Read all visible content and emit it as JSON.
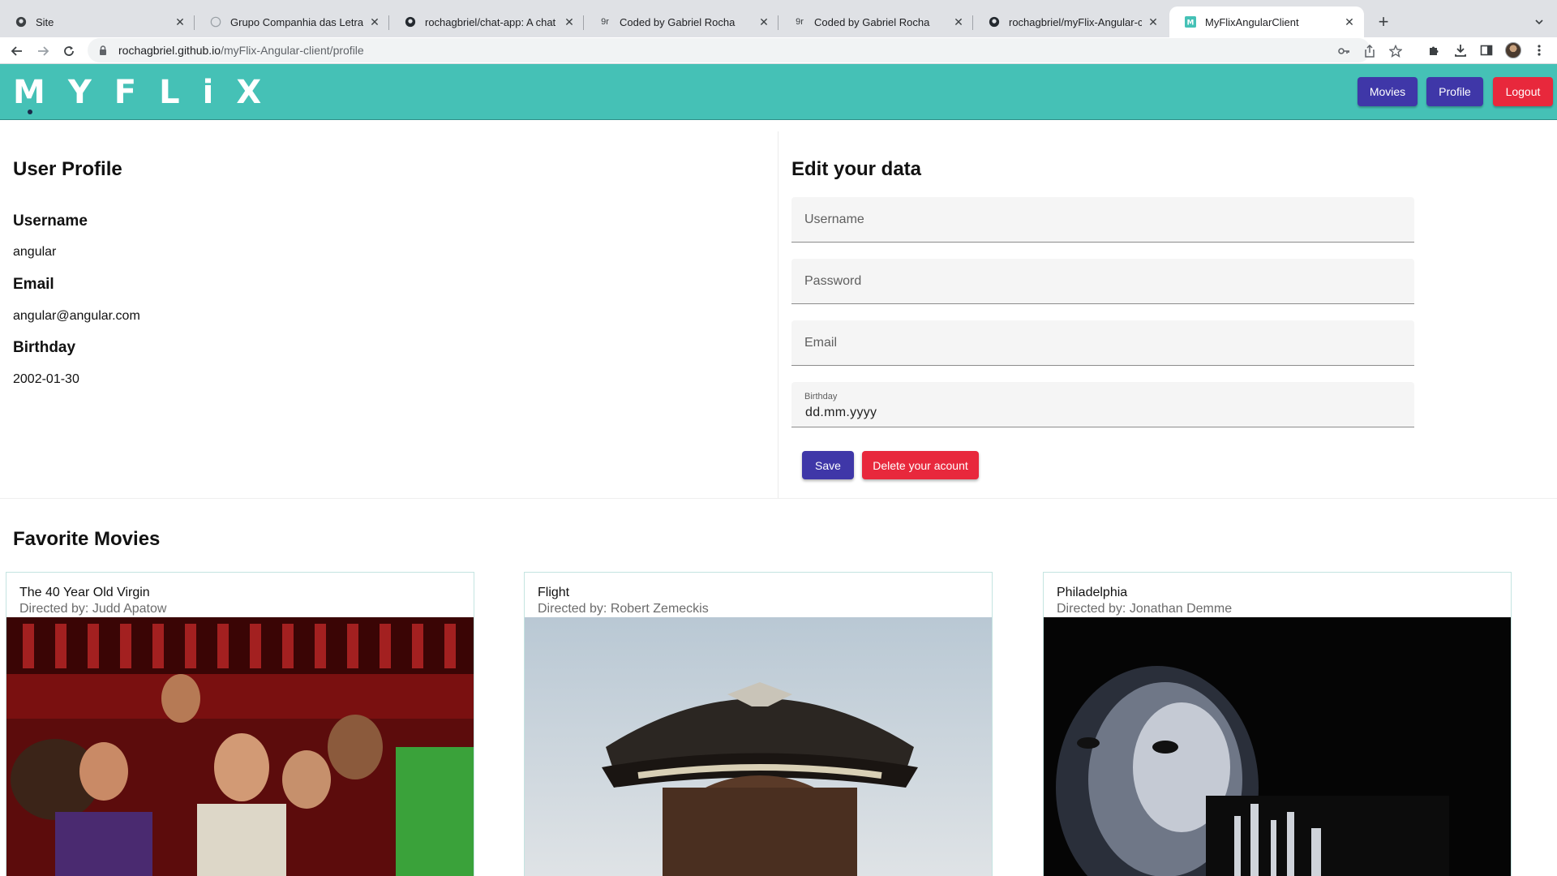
{
  "browser": {
    "tabs": [
      {
        "title": "Site",
        "icon": "github-icon"
      },
      {
        "title": "Grupo Companhia das Letras",
        "icon": "globe-icon"
      },
      {
        "title": "rochagbriel/chat-app: A chat a",
        "icon": "github-icon"
      },
      {
        "title": "Coded by Gabriel Rocha",
        "icon": "gr-logo-icon"
      },
      {
        "title": "Coded by Gabriel Rocha",
        "icon": "gr-logo-icon"
      },
      {
        "title": "rochagbriel/myFlix-Angular-cli",
        "icon": "github-icon"
      },
      {
        "title": "MyFlixAngularClient",
        "icon": "myflix-m-icon",
        "active": true
      }
    ],
    "new_tab": "+",
    "url_host": "rochagbriel.github.io",
    "url_path": "/myFlix-Angular-client/profile"
  },
  "header": {
    "logo_letters": [
      "M",
      "Y",
      "F",
      "L",
      "i",
      "X"
    ],
    "nav": {
      "movies": "Movies",
      "profile": "Profile",
      "logout": "Logout"
    },
    "colors": {
      "bar": "#45c1b6",
      "primary": "#3f37a8",
      "warn": "#e8283c"
    }
  },
  "profile": {
    "title": "User Profile",
    "username_label": "Username",
    "username": "angular",
    "email_label": "Email",
    "email": "angular@angular.com",
    "birthday_label": "Birthday",
    "birthday": "2002-01-30"
  },
  "edit": {
    "title": "Edit your data",
    "username_placeholder": "Username",
    "password_placeholder": "Password",
    "email_placeholder": "Email",
    "birthday_label": "Birthday",
    "birthday_placeholder": "dd.mm.yyyy",
    "save": "Save",
    "delete": "Delete your acount"
  },
  "favorites": {
    "title": "Favorite Movies",
    "movies": [
      {
        "title": "The 40 Year Old Virgin",
        "director": "Directed by: Judd Apatow"
      },
      {
        "title": "Flight",
        "director": "Directed by: Robert Zemeckis"
      },
      {
        "title": "Philadelphia",
        "director": "Directed by: Jonathan Demme"
      }
    ]
  }
}
